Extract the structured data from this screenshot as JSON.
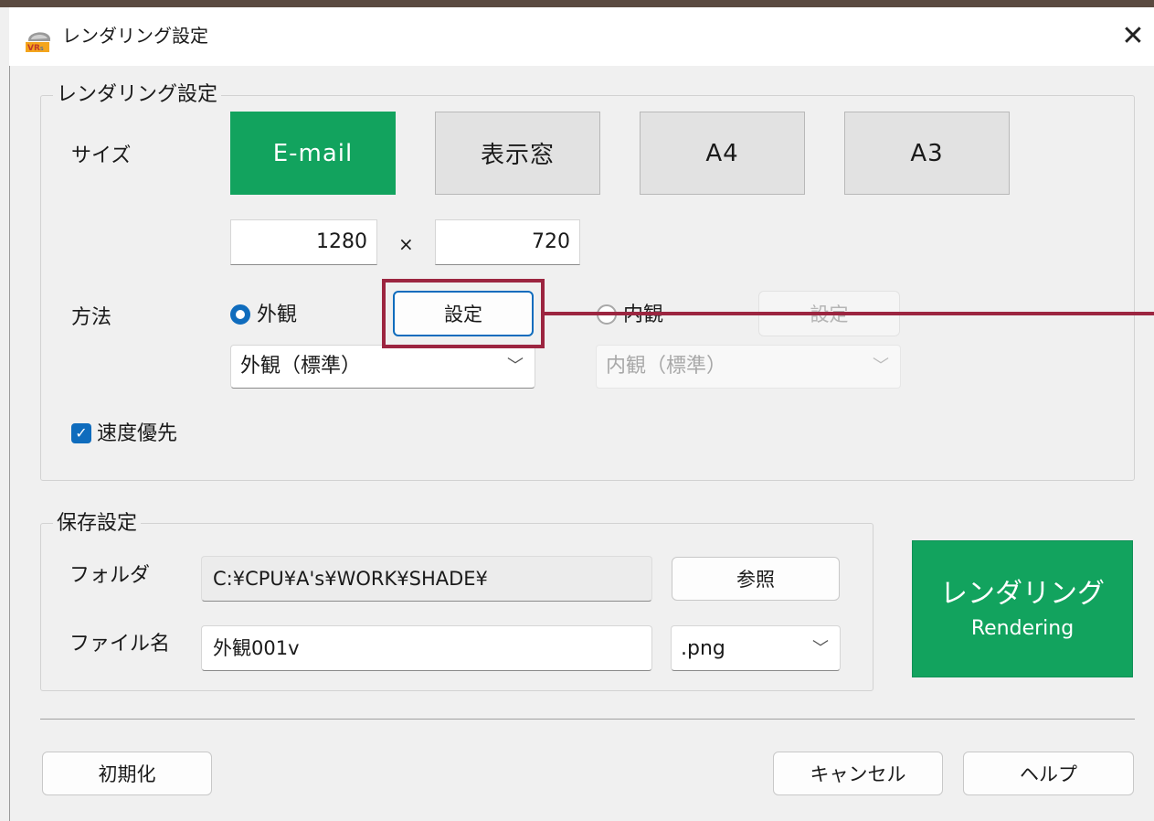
{
  "window": {
    "title": "レンダリング設定",
    "close_glyph": "✕",
    "icon": "vr-app-icon"
  },
  "render_group": {
    "legend": "レンダリング設定",
    "size_label": "サイズ",
    "size_buttons": [
      "E-mail",
      "表示窓",
      "A4",
      "A3"
    ],
    "active_size": "E-mail",
    "width": "1280",
    "times": "×",
    "height": "720",
    "method_label": "方法",
    "exterior": {
      "label": "外観",
      "selected": true,
      "settings_button": "設定",
      "preset": "外観（標準）"
    },
    "interior": {
      "label": "内観",
      "selected": false,
      "settings_button": "設定",
      "preset": "内観（標準）"
    },
    "speed_priority": {
      "label": "速度優先",
      "checked": true
    }
  },
  "save_group": {
    "legend": "保存設定",
    "folder_label": "フォルダ",
    "folder_value": "C:¥CPU¥A's¥WORK¥SHADE¥",
    "browse_button": "参照",
    "filename_label": "ファイル名",
    "filename_value": "外観001v",
    "extension": ".png"
  },
  "render_button": {
    "label": "レンダリング",
    "sublabel": "Rendering"
  },
  "footer": {
    "reset_button": "初期化",
    "cancel_button": "キャンセル",
    "help_button": "ヘルプ"
  },
  "colors": {
    "accent_green": "#12a35e",
    "focus_blue": "#0f6cbd",
    "annotation": "#9c2540"
  }
}
